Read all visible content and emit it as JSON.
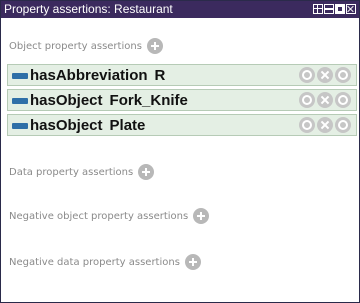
{
  "panel": {
    "title": "Property assertions: Restaurant"
  },
  "sections": {
    "object_property": "Object property assertions",
    "data_property": "Data property assertions",
    "negative_object": "Negative object property assertions",
    "negative_data": "Negative data property assertions"
  },
  "assertions": [
    {
      "property": "hasAbbreviation",
      "value": "R"
    },
    {
      "property": "hasObject",
      "value": "Fork_Knife"
    },
    {
      "property": "hasObject",
      "value": "Plate"
    }
  ],
  "icons": {
    "property": "object-property-icon",
    "add": "add-icon",
    "annotate": "annotation-icon",
    "delete": "delete-icon",
    "edit": "edit-icon"
  },
  "colors": {
    "titlebar": "#3b2a5e",
    "row_bg": "#e4efe4",
    "property_icon": "#2f6fa8"
  }
}
